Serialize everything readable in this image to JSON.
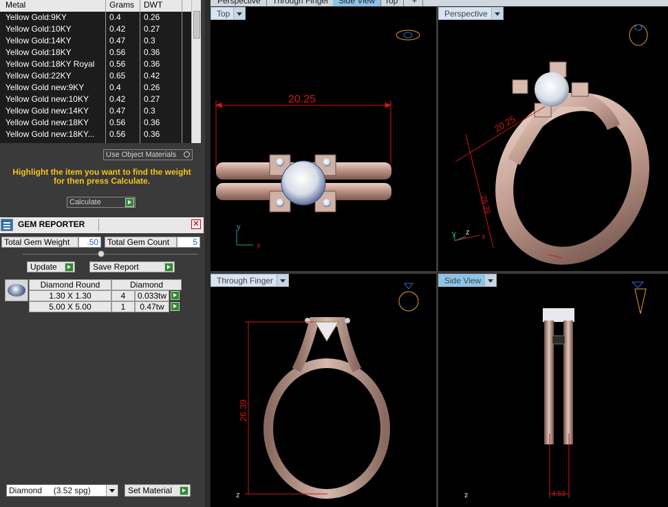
{
  "metal_table": {
    "headers": {
      "metal": "Metal",
      "grams": "Grams",
      "dwt": "DWT"
    },
    "rows": [
      {
        "metal": "Yellow Gold:9KY",
        "grams": "0.4",
        "dwt": "0.26"
      },
      {
        "metal": "Yellow Gold:10KY",
        "grams": "0.42",
        "dwt": "0.27"
      },
      {
        "metal": "Yellow Gold:14KY",
        "grams": "0.47",
        "dwt": "0.3"
      },
      {
        "metal": "Yellow Gold:18KY",
        "grams": "0.56",
        "dwt": "0.36"
      },
      {
        "metal": "Yellow Gold:18KY Royal",
        "grams": "0.56",
        "dwt": "0.36"
      },
      {
        "metal": "Yellow Gold:22KY",
        "grams": "0.65",
        "dwt": "0.42"
      },
      {
        "metal": "Yellow Gold new:9KY",
        "grams": "0.4",
        "dwt": "0.26"
      },
      {
        "metal": "Yellow Gold new:10KY",
        "grams": "0.42",
        "dwt": "0.27"
      },
      {
        "metal": "Yellow Gold new:14KY",
        "grams": "0.47",
        "dwt": "0.3"
      },
      {
        "metal": "Yellow Gold new:18KY",
        "grams": "0.56",
        "dwt": "0.36"
      },
      {
        "metal": "Yellow Gold new:18KY...",
        "grams": "0.56",
        "dwt": "0.36"
      }
    ]
  },
  "use_object_materials": "Use Object Materials",
  "highlight_message": "Highlight the item you want to find the weight for then press Calculate.",
  "calculate_label": "Calculate",
  "gem_reporter": {
    "title": "GEM REPORTER",
    "total_gem_weight_label": "Total Gem Weight",
    "total_gem_weight": ".50",
    "total_gem_count_label": "Total Gem Count",
    "total_gem_count": "5",
    "update_label": "Update",
    "save_report_label": "Save Report",
    "table_headers": {
      "name": "Diamond Round",
      "material": "Diamond"
    },
    "rows": [
      {
        "size": "1.30 X 1.30",
        "count": "4",
        "weight": "0.033tw"
      },
      {
        "size": "5.00 X 5.00",
        "count": "1",
        "weight": "0.47tw"
      }
    ]
  },
  "material_select": "Diamond     (3.52 spg)",
  "set_material_label": "Set Material",
  "top_tabs": [
    "Perspective",
    "Through Finger",
    "Side View",
    "Top",
    "+"
  ],
  "viewports": {
    "top": {
      "label": "Top",
      "dimension": "20.25",
      "axis_y": "y",
      "axis_x": "x"
    },
    "perspective": {
      "label": "Perspective",
      "dim_a": "20.25",
      "dim_b": "26.39",
      "axis_y": "y",
      "axis_z": "z",
      "axis_x": "x"
    },
    "through_finger": {
      "label": "Through Finger",
      "dimension": "26.39",
      "axis_z": "z"
    },
    "side_view": {
      "label": "Side View",
      "dimension": "4.53",
      "axis_z": "z"
    }
  },
  "colors": {
    "accent_message": "#f5c518",
    "metal": "#c9a49a",
    "dimension": "#d01818"
  }
}
